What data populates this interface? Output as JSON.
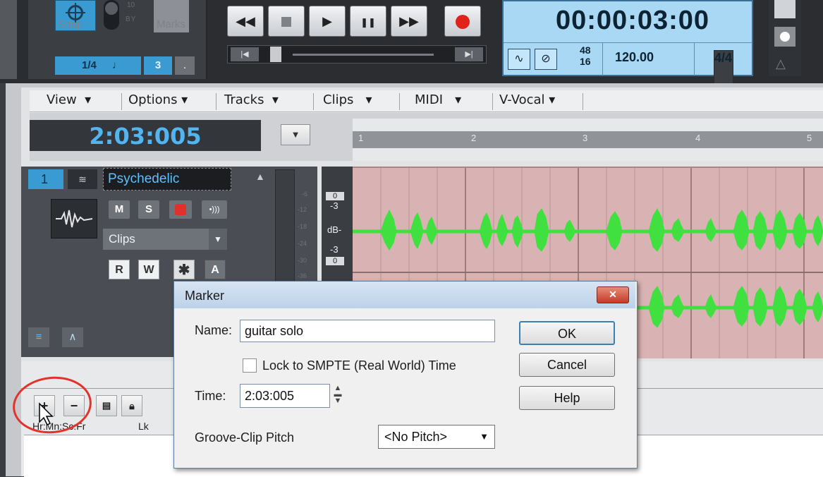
{
  "transport": {
    "snap_label": "Snap",
    "marks_label": "Marks",
    "by_label": "BY",
    "by_value": "10",
    "snap_value": "1/4",
    "snap_note": "♩",
    "snap_tuplet": "3",
    "snap_dot": ".",
    "rewind": "◀◀",
    "play": "▶",
    "pause": "❚❚",
    "fast_forward": "▶▶",
    "time": "00:00:03:00",
    "meter_top": "48",
    "meter_bottom": "16",
    "tempo": "120.00",
    "time_signature": "4/4",
    "pos_home": "|◀",
    "pos_end": "▶|"
  },
  "menubar": {
    "items": [
      "View",
      "Options",
      "Tracks",
      "Clips",
      "MIDI",
      "V-Vocal"
    ]
  },
  "now_time": "2:03:005",
  "ruler": {
    "marks": [
      "1",
      "2",
      "3",
      "4",
      "5"
    ]
  },
  "track": {
    "number": "1",
    "name": "Psychedelic",
    "mute": "M",
    "solo": "S",
    "input_dropdown": "Clips",
    "read": "R",
    "write": "W",
    "star": "✱",
    "automation": "A",
    "meter_labels": [
      "-6",
      "-12",
      "-18",
      "-24",
      "-30",
      "-36"
    ]
  },
  "db_scale": {
    "top_pill": "0",
    "upper": "-3",
    "mid": "dB-",
    "lower": "-3",
    "bottom_pill": "0"
  },
  "markers_pane": {
    "add_button": "+",
    "remove_button": "−",
    "col_time": "Hr:Mn:Sc:Fr",
    "col_lock": "Lk"
  },
  "dialog": {
    "title": "Marker",
    "close": "✕",
    "name_label": "Name:",
    "name_value": "guitar solo",
    "lock_label": "Lock to SMPTE (Real World) Time",
    "time_label": "Time:",
    "time_value": "2:03:005",
    "pitch_label": "Groove-Clip Pitch",
    "pitch_value": "<No Pitch>",
    "ok": "OK",
    "cancel": "Cancel",
    "help": "Help"
  },
  "colors": {
    "accent_blue": "#3a9bd3",
    "waveform_green": "#3fe03f",
    "clip_background": "#d9b3b3",
    "record_red": "#e0221a",
    "annotation_circle": "#e2322a"
  }
}
